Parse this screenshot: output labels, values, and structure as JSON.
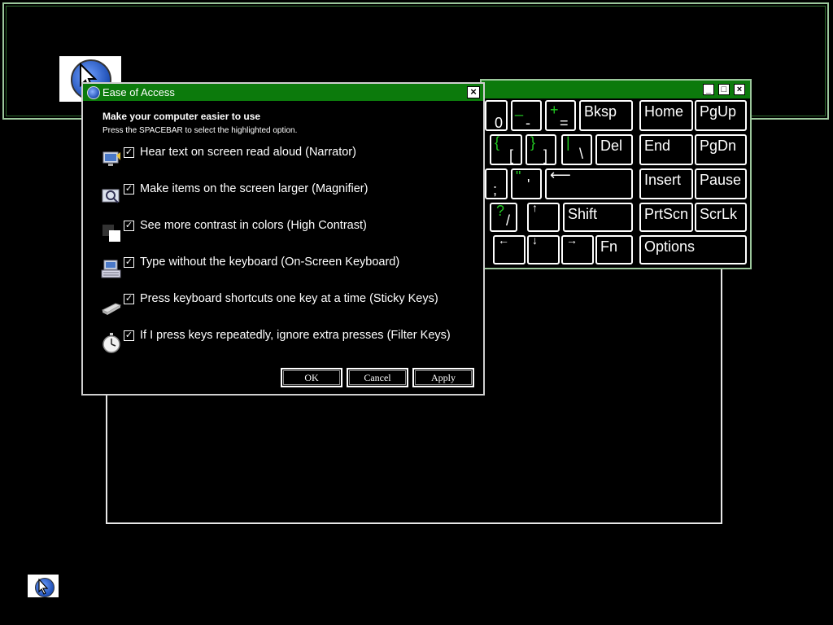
{
  "dialog": {
    "title": "Ease of Access",
    "close_glyph": "×",
    "heading": "Make your computer easier to use",
    "instruction": "Press the SPACEBAR to select the highlighted option.",
    "options": [
      {
        "label": "Hear text on screen read aloud (Narrator)",
        "checked": true,
        "icon": "narrator-icon"
      },
      {
        "label": "Make items on the screen larger (Magnifier)",
        "checked": true,
        "icon": "magnifier-icon"
      },
      {
        "label": "See more contrast in colors (High Contrast)",
        "checked": true,
        "icon": "high-contrast-icon"
      },
      {
        "label": "Type without the keyboard (On-Screen Keyboard)",
        "checked": true,
        "icon": "on-screen-keyboard-icon"
      },
      {
        "label": "Press keyboard shortcuts one key at a time (Sticky Keys)",
        "checked": true,
        "icon": "sticky-keys-icon"
      },
      {
        "label": "If I press keys repeatedly, ignore extra presses (Filter Keys)",
        "checked": true,
        "icon": "filter-keys-icon"
      }
    ],
    "check_glyph": "✓",
    "buttons": {
      "ok": "OK",
      "cancel": "Cancel",
      "apply": "Apply"
    }
  },
  "keyboard": {
    "window_buttons": {
      "minimize": "_",
      "maximize": "□",
      "close": "×"
    },
    "keys": {
      "zero": "0",
      "minus_top": "_",
      "minus": "-",
      "plus_top": "+",
      "equals": "=",
      "bksp": "Bksp",
      "home": "Home",
      "pgup": "PgUp",
      "lbrace_top": "{",
      "lbracket": "[",
      "rbrace_top": "}",
      "rbracket": "]",
      "pipe_top": "|",
      "backslash": "\\",
      "del": "Del",
      "end": "End",
      "pgdn": "PgDn",
      "semicolon": ";",
      "quote_top": "\"",
      "quote": "'",
      "enter": "⟵",
      "insert": "Insert",
      "pause": "Pause",
      "question_top": "?",
      "slash": "/",
      "up": "↑",
      "shift": "Shift",
      "prtscn": "PrtScn",
      "scrlk": "ScrLk",
      "left": "←",
      "down": "↓",
      "right": "→",
      "fn": "Fn",
      "options": "Options"
    }
  },
  "colors": {
    "title_bar": "#0c7a0c",
    "accent_green": "#22cc22",
    "background": "#000000",
    "frame_green": "#9cc79c"
  }
}
